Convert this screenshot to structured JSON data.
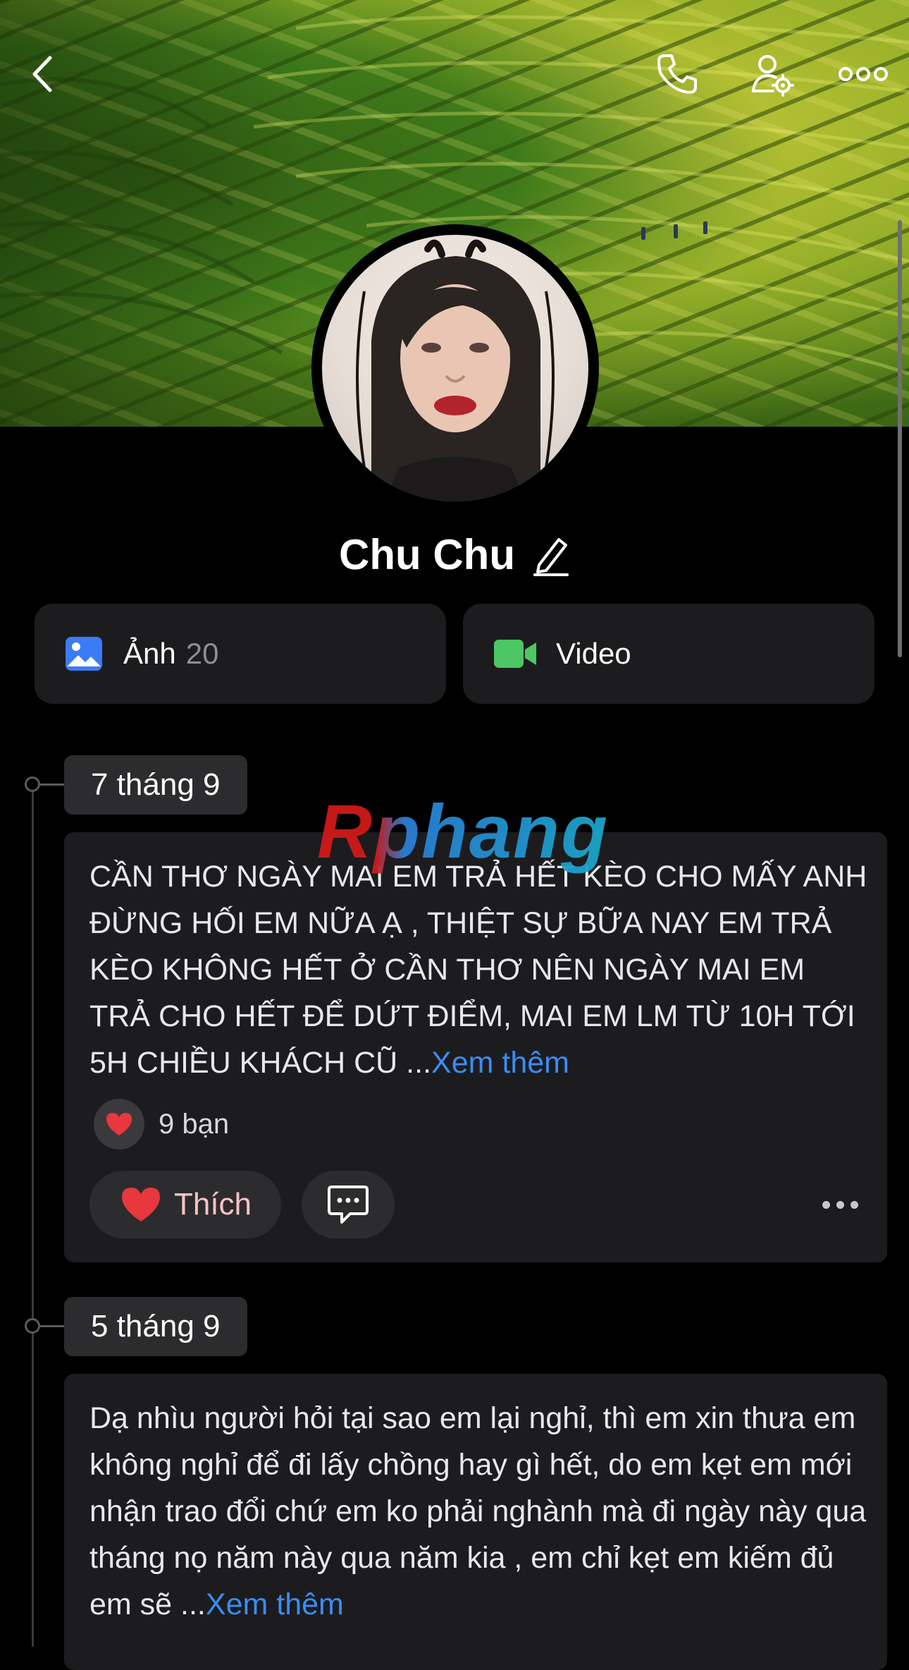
{
  "header": {
    "back_icon": "chevron-left-icon",
    "call_icon": "phone-icon",
    "profile_settings_icon": "user-gear-icon",
    "more_icon": "more-horizontal-icon"
  },
  "profile": {
    "name": "Chu Chu",
    "edit_icon": "pencil-icon"
  },
  "media": {
    "photos_label": "Ảnh",
    "photos_count": "20",
    "video_label": "Video"
  },
  "watermark": "Rphang",
  "posts": [
    {
      "date": "7 tháng 9",
      "text": "CẦN THƠ NGÀY MAI EM TRẢ HẾT KÈO CHO MẤY ANH ĐỪNG HỐI EM NỮA Ạ , THIỆT SỰ BỮA NAY EM TRẢ KÈO KHÔNG HẾT Ở CẦN THƠ NÊN NGÀY MAI EM TRẢ CHO HẾT ĐỂ DỨT ĐIỂM, MAI EM LM TỪ 10H TỚI 5H CHIỀU KHÁCH CŨ ...",
      "see_more": "Xem thêm",
      "reactions": "9 bạn",
      "like_label": "Thích"
    },
    {
      "date": "5 tháng 9",
      "text": "Dạ nhìu người hỏi tại sao em lại nghỉ, thì em xin thưa em không nghỉ để đi lấy chồng hay gì hết, do em kẹt em mới nhận trao đổi chứ em ko phải nghành mà đi ngày này qua tháng nọ năm này qua năm kia , em chỉ kẹt em kiếm đủ em sẽ ...",
      "see_more": "Xem thêm"
    }
  ],
  "colors": {
    "background": "#000000",
    "card": "#1c1c1e",
    "link": "#3b8cf5",
    "like_text": "#f7c4c4",
    "photo_icon": "#3a7bf6",
    "video_icon": "#4cc764"
  }
}
